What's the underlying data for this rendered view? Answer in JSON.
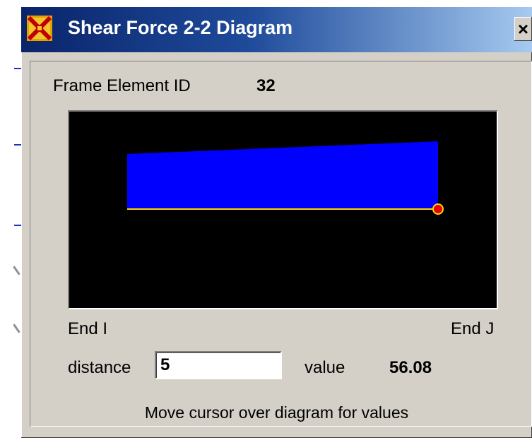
{
  "window": {
    "title": "Shear Force 2-2 Diagram",
    "close_label": "×"
  },
  "frame": {
    "label": "Frame Element ID",
    "value": "32"
  },
  "diagram": {
    "end_i_label": "End I",
    "end_j_label": "End J",
    "fill_color": "#0000ff",
    "baseline_color": "#ffd700",
    "marker_color": "#e60000",
    "background_color": "#000000"
  },
  "readout": {
    "distance_label": "distance",
    "distance_value": "5",
    "value_label": "value",
    "value_number": "56.08"
  },
  "hint": "Move cursor over diagram for values"
}
